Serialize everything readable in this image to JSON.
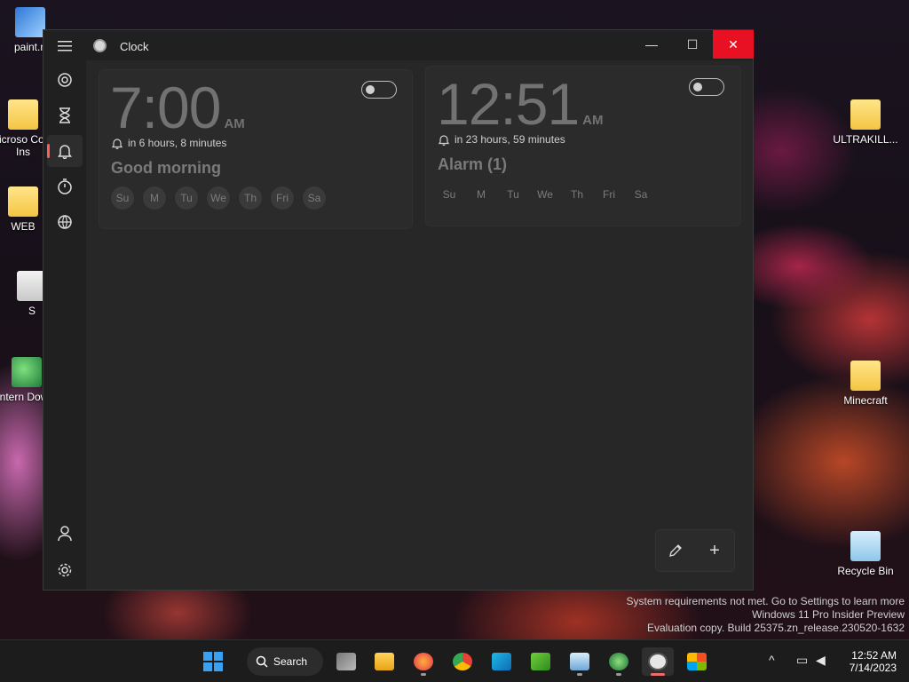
{
  "desktop": {
    "icons": [
      {
        "label": "paint.n",
        "icon": "paint-icon"
      },
      {
        "label": "Microso Code Ins",
        "icon": "folder-icon"
      },
      {
        "label": "WEB",
        "icon": "chrome-folder-icon"
      },
      {
        "label": "S",
        "icon": "document-icon"
      },
      {
        "label": "Intern Downl",
        "icon": "globe-icon"
      },
      {
        "label": "ULTRAKILL...",
        "icon": "folder-icon"
      },
      {
        "label": "Minecraft",
        "icon": "folder-icon"
      },
      {
        "label": "Recycle Bin",
        "icon": "recycle-bin-icon"
      }
    ]
  },
  "window": {
    "title": "Clock",
    "controls": {
      "minimize": "—",
      "maximize": "☐",
      "close": "✕"
    }
  },
  "nav": {
    "items": [
      {
        "id": "focus",
        "icon": "focus-icon"
      },
      {
        "id": "timer",
        "icon": "hourglass-icon"
      },
      {
        "id": "alarm",
        "icon": "bell-icon",
        "active": true
      },
      {
        "id": "stopwatch",
        "icon": "stopwatch-icon"
      },
      {
        "id": "world-clock",
        "icon": "globe-icon"
      }
    ],
    "bottom": [
      {
        "id": "account",
        "icon": "person-icon"
      },
      {
        "id": "settings",
        "icon": "gear-icon"
      }
    ]
  },
  "alarms": [
    {
      "time": "7:00",
      "ampm": "AM",
      "remaining": "in 6 hours, 8 minutes",
      "name": "Good morning",
      "days": [
        "Su",
        "M",
        "Tu",
        "We",
        "Th",
        "Fri",
        "Sa"
      ],
      "enabled": false
    },
    {
      "time": "12:51",
      "ampm": "AM",
      "remaining": "in 23 hours, 59 minutes",
      "name": "Alarm (1)",
      "days": [
        "Su",
        "M",
        "Tu",
        "We",
        "Th",
        "Fri",
        "Sa"
      ],
      "enabled": false
    }
  ],
  "fab": {
    "edit_icon": "pencil-icon",
    "add_icon": "plus-icon",
    "add_label": "+"
  },
  "watermark": {
    "line1": "System requirements not met. Go to Settings to learn more",
    "line2": "Windows 11 Pro Insider Preview",
    "line3": "Evaluation copy. Build 25375.zn_release.230520-1632"
  },
  "taskbar": {
    "search_label": "Search",
    "time": "12:52 AM",
    "date": "7/14/2023",
    "colors": {
      "accent": "#f06a6a",
      "close": "#e81123"
    }
  }
}
